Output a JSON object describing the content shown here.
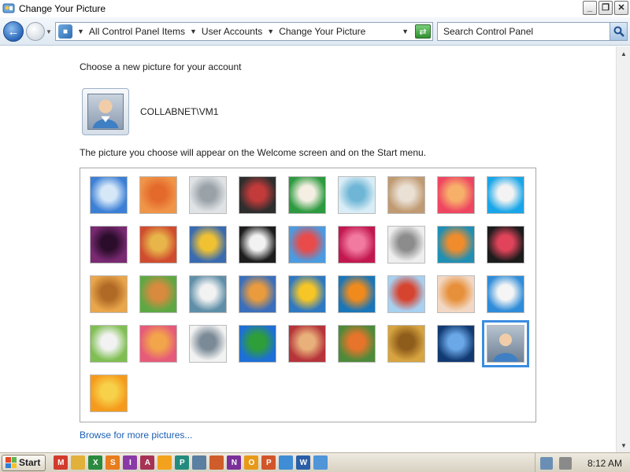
{
  "window": {
    "title": "Change Your Picture"
  },
  "address": {
    "crumbs": [
      "All Control Panel Items",
      "User Accounts",
      "Change Your Picture"
    ],
    "search_placeholder": "Search Control Panel"
  },
  "content": {
    "heading": "Choose a new picture for your account",
    "username": "COLLABNET\\VM1",
    "description": "The picture you choose will appear on the Welcome screen and on the Start menu.",
    "browse_link": "Browse for more pictures..."
  },
  "pictures": [
    {
      "name": "roller-coaster-picture",
      "c1": "#3b7fd6",
      "c2": "#d6e8f8"
    },
    {
      "name": "starfish-picture",
      "c1": "#f09548",
      "c2": "#e46a2c"
    },
    {
      "name": "robot-picture",
      "c1": "#dfe3e6",
      "c2": "#9aa2a8"
    },
    {
      "name": "record-player-picture",
      "c1": "#2e2e2e",
      "c2": "#c23a3a"
    },
    {
      "name": "lucky-cat-picture",
      "c1": "#2d9a3f",
      "c2": "#f4efe2"
    },
    {
      "name": "gyroscope-picture",
      "c1": "#d9edf6",
      "c2": "#6fb6d6"
    },
    {
      "name": "kitten-picture",
      "c1": "#c09a72",
      "c2": "#eae0d4"
    },
    {
      "name": "flower-picture",
      "c1": "#ee4561",
      "c2": "#f7b06a"
    },
    {
      "name": "pinwheel-picture",
      "c1": "#19a6e8",
      "c2": "#f3f3f3"
    },
    {
      "name": "ball-picture",
      "c1": "#7a2a73",
      "c2": "#2b0d2b"
    },
    {
      "name": "fabric-picture",
      "c1": "#d04c2f",
      "c2": "#e8b54a"
    },
    {
      "name": "leaf-picture",
      "c1": "#3a6bb0",
      "c2": "#f0c233"
    },
    {
      "name": "dog-picture",
      "c1": "#1d1d1d",
      "c2": "#f2f2f2"
    },
    {
      "name": "crayons-picture",
      "c1": "#4c9be0",
      "c2": "#e94b4b"
    },
    {
      "name": "pink-star-picture",
      "c1": "#c2184f",
      "c2": "#f27aa0"
    },
    {
      "name": "jacks-picture",
      "c1": "#eeeeee",
      "c2": "#8c8c8c"
    },
    {
      "name": "stairs-picture",
      "c1": "#1f8fb4",
      "c2": "#f08c2c"
    },
    {
      "name": "paper-crane-picture",
      "c1": "#1c1c1c",
      "c2": "#e0435a"
    },
    {
      "name": "guitar-picture",
      "c1": "#e9a64b",
      "c2": "#b06a25"
    },
    {
      "name": "puppy-picture",
      "c1": "#5ea844",
      "c2": "#d88a3e"
    },
    {
      "name": "toy-robot-picture",
      "c1": "#5f8fa8",
      "c2": "#f2f2f2"
    },
    {
      "name": "scarf-picture",
      "c1": "#3b6fbb",
      "c2": "#e99b3d"
    },
    {
      "name": "sunflower-picture",
      "c1": "#2f78c2",
      "c2": "#f5c626"
    },
    {
      "name": "fish-picture",
      "c1": "#1976b8",
      "c2": "#f08a1c"
    },
    {
      "name": "balloon-picture",
      "c1": "#a8d0ef",
      "c2": "#d6432f"
    },
    {
      "name": "doll-picture",
      "c1": "#f2d8c4",
      "c2": "#e7903a"
    },
    {
      "name": "sailboat-picture",
      "c1": "#2f8cd8",
      "c2": "#f5f5f5"
    },
    {
      "name": "soccer-ball-picture",
      "c1": "#7fbf52",
      "c2": "#f2f2f2"
    },
    {
      "name": "textile-picture",
      "c1": "#e65a7a",
      "c2": "#f2a54a"
    },
    {
      "name": "marbles-picture",
      "c1": "#f2f2f2",
      "c2": "#7a8a96"
    },
    {
      "name": "window-picture",
      "c1": "#1e6fd6",
      "c2": "#2e9e3a"
    },
    {
      "name": "weave-picture",
      "c1": "#b6343a",
      "c2": "#e8b07a"
    },
    {
      "name": "butterfly-picture",
      "c1": "#4f8a3a",
      "c2": "#e6742a"
    },
    {
      "name": "basket-picture",
      "c1": "#d7a440",
      "c2": "#8f5d1b"
    },
    {
      "name": "lighthouse-picture",
      "c1": "#123a72",
      "c2": "#6aa8e8"
    },
    {
      "name": "default-user-picture",
      "c1": "#b7c3cf",
      "c2": "#6d7f94",
      "selected": true
    },
    {
      "name": "gerbera-picture",
      "c1": "#f59a1c",
      "c2": "#f7d14a"
    }
  ],
  "taskbar": {
    "start_label": "Start",
    "clock": "8:12 AM",
    "quick_launch": [
      {
        "name": "gmail-icon",
        "glyph": "M",
        "color": "#d23c2c"
      },
      {
        "name": "folder-icon",
        "glyph": "",
        "color": "#e2b13c"
      },
      {
        "name": "excel-icon",
        "glyph": "X",
        "color": "#2a8a3e"
      },
      {
        "name": "sharepoint-icon",
        "glyph": "S",
        "color": "#e87d1e"
      },
      {
        "name": "infopath-icon",
        "glyph": "I",
        "color": "#8a3aa6"
      },
      {
        "name": "access-icon",
        "glyph": "A",
        "color": "#a63355"
      },
      {
        "name": "sun-icon",
        "glyph": "",
        "color": "#f3a21e"
      },
      {
        "name": "publisher-icon",
        "glyph": "P",
        "color": "#238c7e"
      },
      {
        "name": "contact-icon",
        "glyph": "",
        "color": "#5a7fa0"
      },
      {
        "name": "picture-manager-icon",
        "glyph": "",
        "color": "#cf5d2b"
      },
      {
        "name": "onenote-icon",
        "glyph": "N",
        "color": "#7a2f9a"
      },
      {
        "name": "outlook-icon",
        "glyph": "O",
        "color": "#e79a1a"
      },
      {
        "name": "powerpoint-icon",
        "glyph": "P",
        "color": "#d2552a"
      },
      {
        "name": "clip-organizer-icon",
        "glyph": "",
        "color": "#3f8dd4"
      },
      {
        "name": "word-icon",
        "glyph": "W",
        "color": "#2b5ea8"
      },
      {
        "name": "control-panel-taskbar-icon",
        "glyph": "",
        "color": "#4f95d8"
      }
    ]
  },
  "titlebar_buttons": {
    "minimize": "_",
    "restore": "❐",
    "close": "✕"
  }
}
